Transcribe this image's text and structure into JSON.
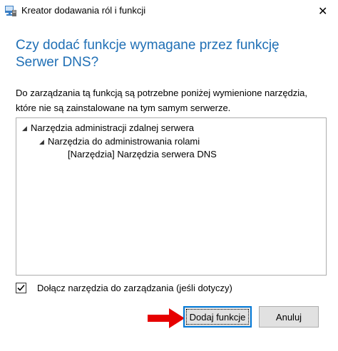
{
  "window": {
    "title": "Kreator dodawania ról i funkcji"
  },
  "heading": "Czy dodać funkcje wymagane przez funkcję Serwer DNS?",
  "description": "Do zarządzania tą funkcją są potrzebne poniżej wymienione narzędzia, które nie są zainstalowane na tym samym serwerze.",
  "tree": [
    {
      "label": "Narzędzia administracji zdalnej serwera",
      "expanded": true
    },
    {
      "label": "Narzędzia do administrowania rolami",
      "expanded": true
    },
    {
      "label": "[Narzędzia] Narzędzia serwera DNS",
      "expanded": false
    }
  ],
  "include_tools": {
    "label": "Dołącz narzędzia do zarządzania (jeśli dotyczy)",
    "checked": true
  },
  "buttons": {
    "add": "Dodaj funkcje",
    "cancel": "Anuluj"
  },
  "colors": {
    "heading": "#1f6fb5",
    "arrow": "#e60000",
    "focus": "#0078d7"
  }
}
